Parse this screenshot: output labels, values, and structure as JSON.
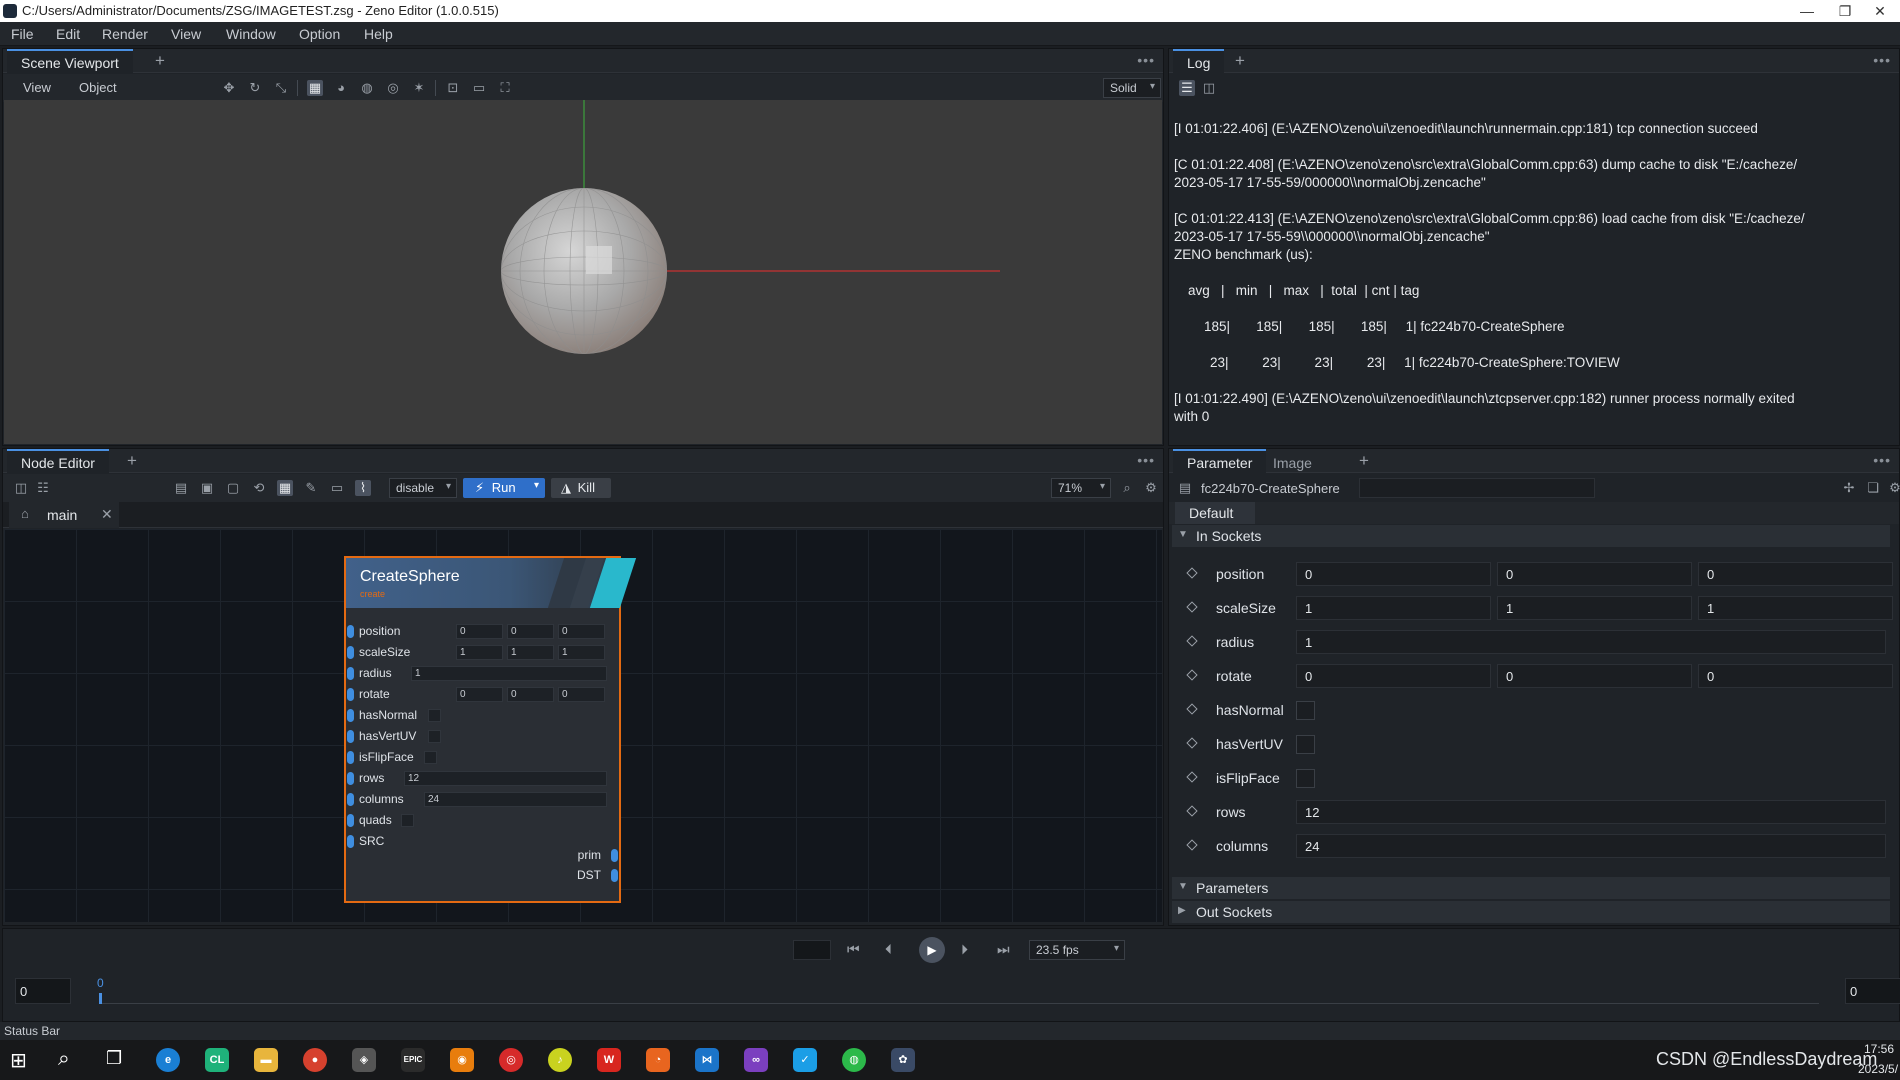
{
  "window": {
    "title": "C:/Users/Administrator/Documents/ZSG/IMAGETEST.zsg - Zeno Editor (1.0.0.515)",
    "min_glyph": "—",
    "max_glyph": "❐",
    "close_glyph": "✕"
  },
  "menubar": [
    "File",
    "Edit",
    "Render",
    "View",
    "Window",
    "Option",
    "Help"
  ],
  "viewport": {
    "tab": "Scene Viewport",
    "menu_view": "View",
    "menu_object": "Object",
    "shading_mode": "Solid"
  },
  "log": {
    "tab": "Log",
    "lines": [
      "[I 01:01:22.406] (E:\\AZENO\\zeno\\ui\\zenoedit\\launch\\runnermain.cpp:181) tcp connection succeed",
      "[C 01:01:22.408] (E:\\AZENO\\zeno\\zeno\\src\\extra\\GlobalComm.cpp:63) dump cache to disk \"E:/cacheze/",
      "2023-05-17 17-55-59/000000\\\\normalObj.zencache\"",
      "[C 01:01:22.413] (E:\\AZENO\\zeno\\zeno\\src\\extra\\GlobalComm.cpp:86) load cache from disk \"E:/cacheze/",
      "2023-05-17 17-55-59\\\\000000\\\\normalObj.zencache\"",
      "ZENO benchmark (us):",
      "avg   |   min   |   max   |  total  | cnt | tag",
      "185|       185|       185|       185|     1| fc224b70-CreateSphere",
      "23|         23|         23|         23|     1| fc224b70-CreateSphere:TOVIEW",
      "[I 01:01:22.490] (E:\\AZENO\\zeno\\ui\\zenoedit\\launch\\ztcpserver.cpp:182) runner process normally exited",
      "with 0"
    ]
  },
  "node_editor": {
    "tab": "Node Editor",
    "mode": "disable",
    "run_label": "Run",
    "kill_label": "Kill",
    "zoom": "71%",
    "subgraph_tab": "main"
  },
  "node": {
    "title": "CreateSphere",
    "subtitle": "create",
    "inputs": [
      {
        "name": "position",
        "values": [
          "0",
          "0",
          "0"
        ]
      },
      {
        "name": "scaleSize",
        "values": [
          "1",
          "1",
          "1"
        ]
      },
      {
        "name": "radius",
        "values": [
          "1"
        ]
      },
      {
        "name": "rotate",
        "values": [
          "0",
          "0",
          "0"
        ]
      },
      {
        "name": "hasNormal",
        "values": []
      },
      {
        "name": "hasVertUV",
        "values": []
      },
      {
        "name": "isFlipFace",
        "values": []
      },
      {
        "name": "rows",
        "values": [
          "12"
        ]
      },
      {
        "name": "columns",
        "values": [
          "24"
        ]
      },
      {
        "name": "quads",
        "values": []
      },
      {
        "name": "SRC",
        "values": []
      }
    ],
    "outputs": [
      "prim",
      "DST"
    ]
  },
  "parameter": {
    "tab_parameter": "Parameter",
    "tab_image": "Image",
    "node_ident": "fc224b70-CreateSphere",
    "default_tab": "Default",
    "in_sockets": "In Sockets",
    "parameters": "Parameters",
    "out_sockets": "Out Sockets",
    "rows": [
      {
        "name": "position",
        "values": [
          "0",
          "0",
          "0"
        ]
      },
      {
        "name": "scaleSize",
        "values": [
          "1",
          "1",
          "1"
        ]
      },
      {
        "name": "radius",
        "values": [
          "1"
        ]
      },
      {
        "name": "rotate",
        "values": [
          "0",
          "0",
          "0"
        ]
      },
      {
        "name": "hasNormal",
        "values": []
      },
      {
        "name": "hasVertUV",
        "values": []
      },
      {
        "name": "isFlipFace",
        "values": []
      },
      {
        "name": "rows",
        "values": [
          "12"
        ]
      },
      {
        "name": "columns",
        "values": [
          "24"
        ]
      }
    ]
  },
  "timeline": {
    "fps": "23.5 fps",
    "start_frame": "0",
    "current_frame": "0",
    "end_frame": "0"
  },
  "status_bar": "Status Bar",
  "taskbar": {
    "watermark": "CSDN @EndlessDaydream",
    "time": "17:56",
    "date": "2023/5/"
  },
  "colors": {
    "accent": "#4a90e2",
    "node_selected_border": "#e46a12",
    "socket": "#3f8ee0",
    "run_button": "#2f6fc9"
  }
}
